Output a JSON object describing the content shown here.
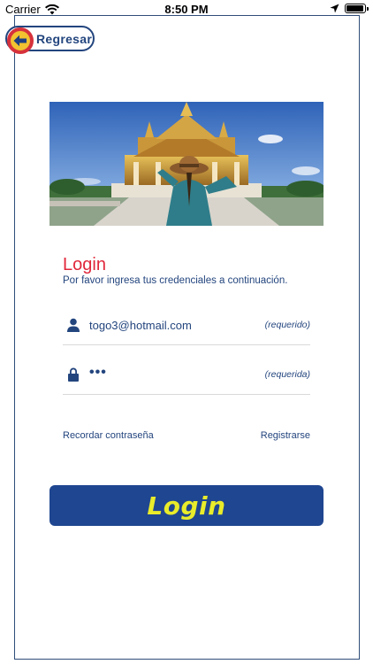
{
  "status_bar": {
    "carrier": "Carrier",
    "time": "8:50 PM",
    "battery_level": 0.95
  },
  "back_button": {
    "label": "Regresar",
    "icon": "arrow-left-icon"
  },
  "hero_image": {
    "subject": "traveler-at-thai-temple"
  },
  "login_form": {
    "title": "Login",
    "subtitle": "Por favor ingresa tus credenciales a continuación.",
    "email": {
      "value": "togo3@hotmail.com",
      "required_label": "(requerido)",
      "icon": "user-icon"
    },
    "password": {
      "value": "•••",
      "required_label": "(requerida)",
      "icon": "lock-icon"
    },
    "remember_label": "Recordar contraseña",
    "register_label": "Registrarse",
    "submit_label": "Login"
  },
  "colors": {
    "primary": "#1f4690",
    "accent_red": "#e0273a",
    "button_text": "#e9ec2a"
  }
}
